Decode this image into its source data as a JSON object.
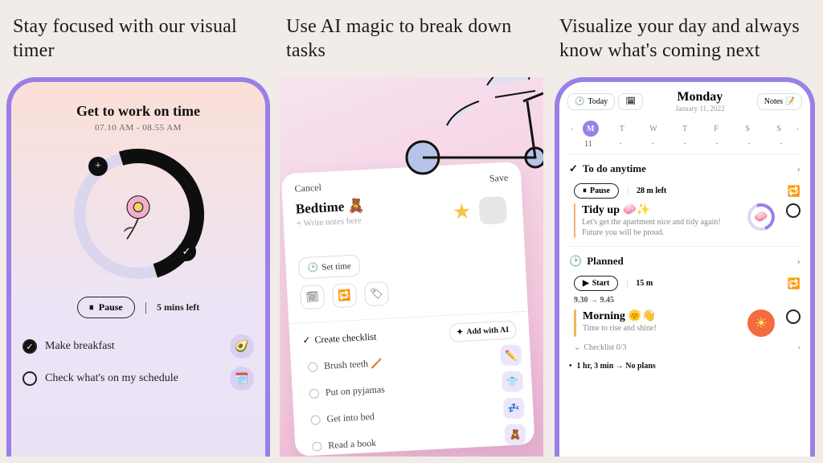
{
  "panels": {
    "p1_heading": "Stay focused with our visual timer",
    "p2_heading": "Use AI magic to break down tasks",
    "p3_heading": "Visualize your day and always know what's coming next"
  },
  "timer": {
    "title": "Get to work on time",
    "range": "07.10 AM - 08.55 AM",
    "pause_label": "Pause",
    "remaining": "5 mins left",
    "tasks": [
      {
        "label": "Make breakfast",
        "done": true,
        "icon": "🥑"
      },
      {
        "label": "Check what's on my schedule",
        "done": false,
        "icon": "🗓️"
      }
    ]
  },
  "editor": {
    "cancel": "Cancel",
    "save": "Save",
    "task_name": "Bedtime 🧸",
    "notes_placeholder": "+ Write notes here",
    "set_time": "Set time",
    "checklist_label": "Create checklist",
    "add_ai": "Add with AI",
    "items": [
      {
        "label": "Brush teeth 🪥",
        "icon": "✏️"
      },
      {
        "label": "Put on pyjamas",
        "icon": "👕"
      },
      {
        "label": "Get into bed",
        "icon": "💤"
      },
      {
        "label": "Read a book",
        "icon": "🧸"
      }
    ]
  },
  "calendar": {
    "today": "Today",
    "notes": "Notes 📝",
    "day_name": "Monday",
    "date": "January 11, 2022",
    "week_labels": [
      "M",
      "T",
      "W",
      "T",
      "F",
      "S",
      "S"
    ],
    "week_nums": [
      "11",
      "",
      "",
      "",
      "",
      "",
      ""
    ],
    "todo_header": "To do anytime",
    "item1": {
      "status": "Pause",
      "duration": "28 m left",
      "name": "Tidy up 🧼✨",
      "desc": "Let's get the apartment nice and tidy again! Future you will be proud."
    },
    "planned_header": "Planned",
    "item2": {
      "status": "Start",
      "duration": "15 m",
      "time_range": "9.30 → 9.45",
      "name": "Morning 🌞👋",
      "desc": "Time to rise and shine!",
      "checklist": "Checklist 0/3"
    },
    "footer": "1 hr, 3 min → No plans"
  }
}
